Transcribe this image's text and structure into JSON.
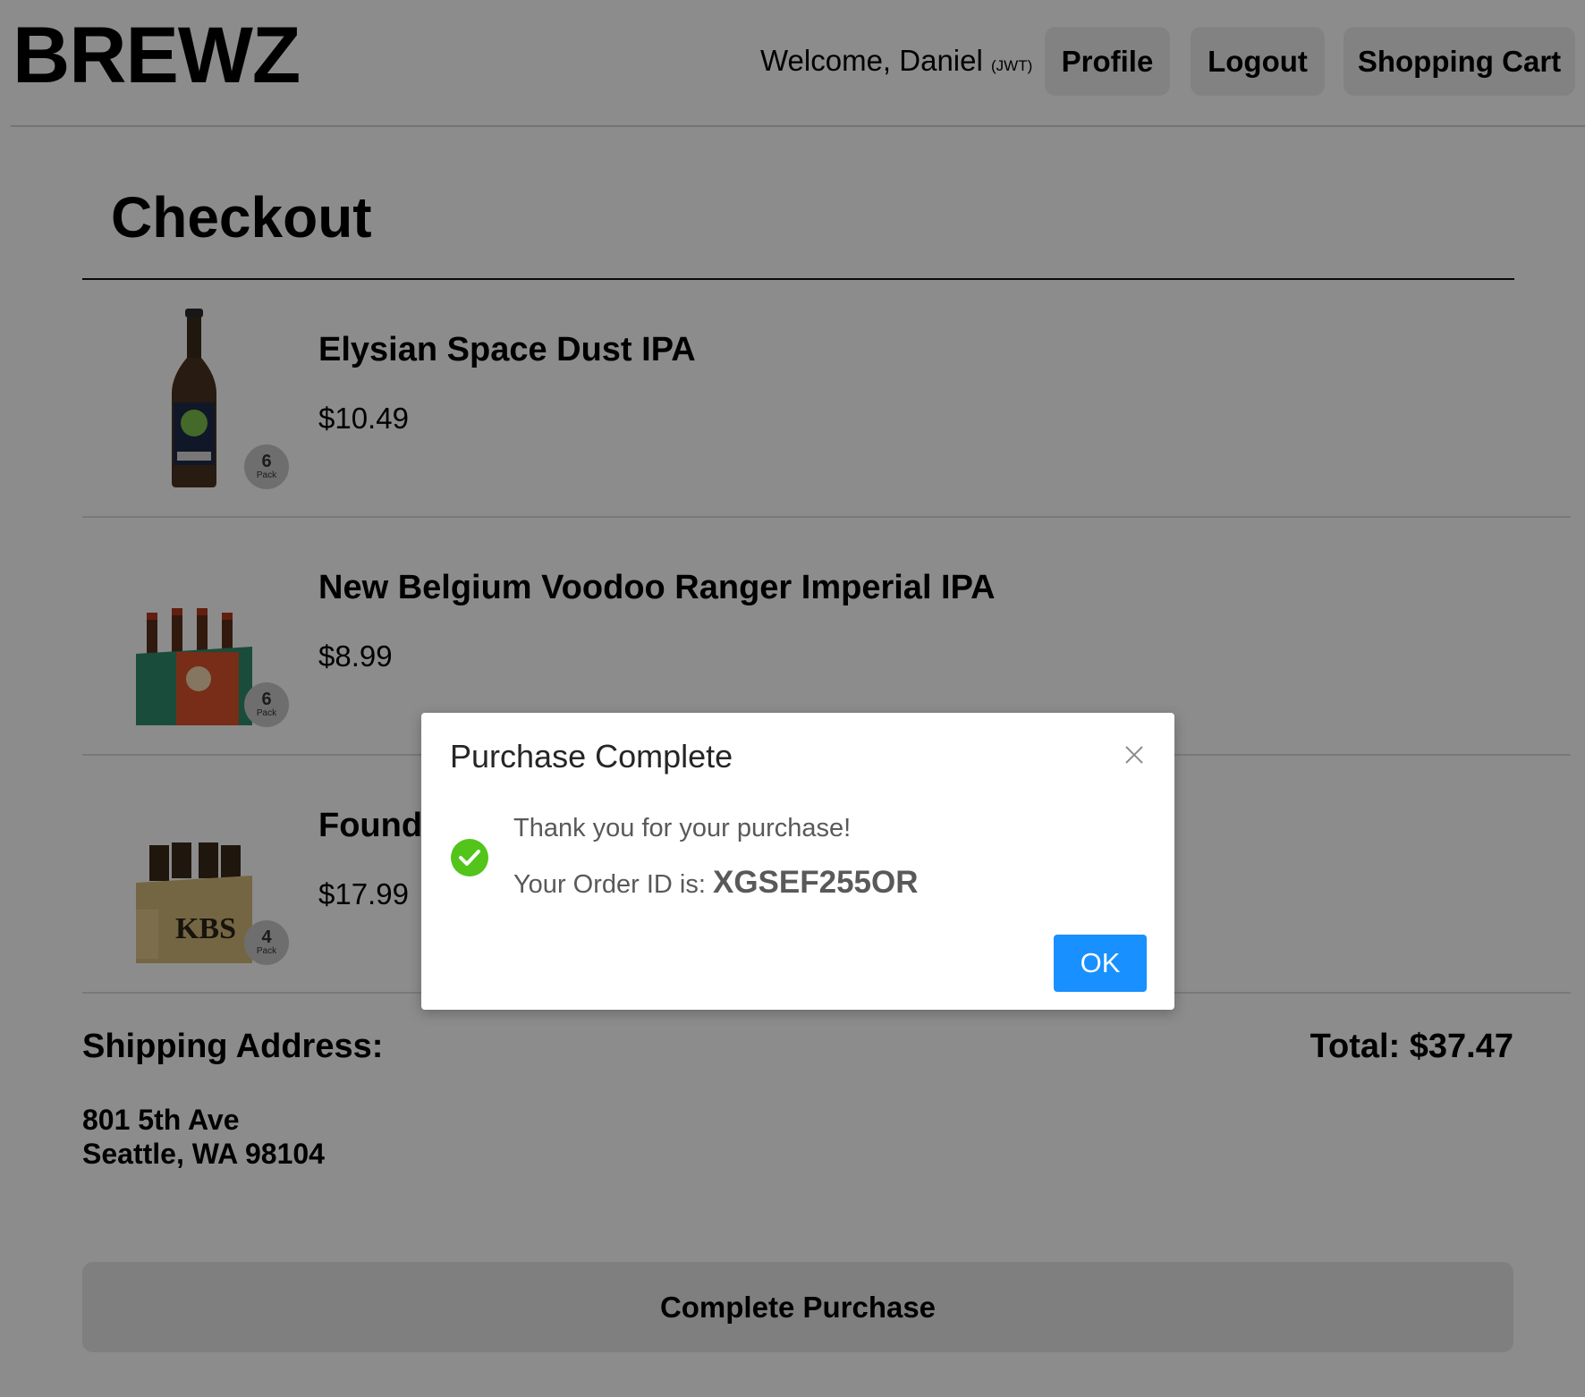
{
  "header": {
    "logo": "BREWZ",
    "welcome": "Welcome, Daniel",
    "auth_tag": "(JWT)",
    "nav": {
      "profile": "Profile",
      "logout": "Logout",
      "cart": "Shopping Cart"
    }
  },
  "checkout": {
    "title": "Checkout",
    "items": [
      {
        "name": "Elysian Space Dust IPA",
        "price": "$10.49",
        "pack_count": "6",
        "pack_label": "Pack",
        "image_icon": "beer-bottle-icon"
      },
      {
        "name": "New Belgium Voodoo Ranger Imperial IPA",
        "price": "$8.99",
        "pack_count": "6",
        "pack_label": "Pack",
        "image_icon": "six-pack-icon"
      },
      {
        "name": "Found",
        "price": "$17.99",
        "pack_count": "4",
        "pack_label": "Pack",
        "image_icon": "four-pack-icon",
        "image_text": "KBS"
      }
    ],
    "shipping_label": "Shipping Address:",
    "address_line1": "801 5th Ave",
    "address_line2": "Seattle, WA 98104",
    "total": "Total: $37.47",
    "complete_button": "Complete Purchase"
  },
  "modal": {
    "title": "Purchase Complete",
    "message": "Thank you for your purchase!",
    "order_label": "Your Order ID is:",
    "order_id": "XGSEF255OR",
    "ok_button": "OK",
    "status_icon": "check-circle-icon",
    "success_color": "#52c41a",
    "primary_color": "#1890ff"
  }
}
